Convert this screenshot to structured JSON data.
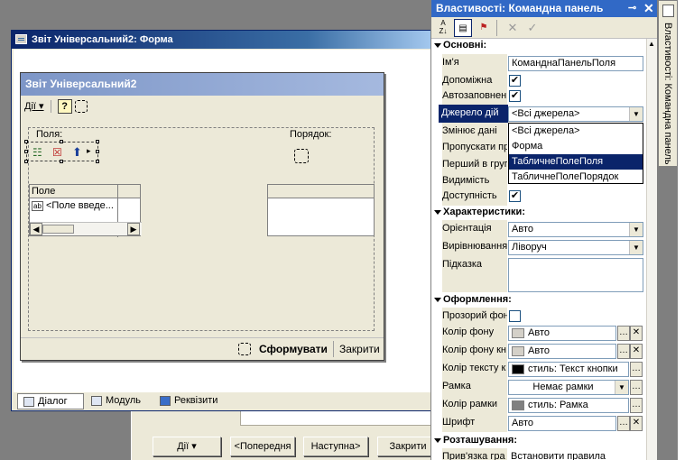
{
  "form_window": {
    "title": "Звіт Універсальний2: Форма",
    "tabs": [
      {
        "label": "Діалог",
        "icon": "dialog-icon"
      },
      {
        "label": "Модуль",
        "icon": "module-icon"
      },
      {
        "label": "Реквізити",
        "icon": "attributes-icon"
      }
    ]
  },
  "inner_form": {
    "title": "Звіт  Універсальний2",
    "menu_label": "Дії",
    "fields_label": "Поля:",
    "order_label": "Порядок:",
    "fields_table": {
      "header": "Поле",
      "row": "<Поле введе..."
    },
    "generate_button": "Сформувати",
    "close_button": "Закрити"
  },
  "background_dialog": {
    "buttons": [
      "Дії",
      "<Попередня",
      "Наступна>",
      "Закрити"
    ]
  },
  "properties": {
    "title": "Властивості: Командна панель",
    "pin_icon": "pin-icon",
    "close_icon": "close-icon",
    "sections": {
      "main": "Основні:",
      "characteristics": "Характеристики:",
      "appearance": "Оформлення:",
      "placement": "Розташування:"
    },
    "rows": {
      "name": {
        "label": "Ім'я",
        "value": "КоманднаПанельПоля"
      },
      "auxiliary": {
        "label": "Допоміжна",
        "checked": true
      },
      "autofill": {
        "label": "Автозаповнен",
        "checked": true
      },
      "action_source": {
        "label": "Джерело дій",
        "value": "<Всі джерела>"
      },
      "changes_data": {
        "label": "Змінює дані"
      },
      "skip": {
        "label": "Пропускати пр"
      },
      "first_group": {
        "label": "Перший в груп"
      },
      "visibility": {
        "label": "Видимість"
      },
      "availability": {
        "label": "Доступність",
        "checked": true
      },
      "orientation": {
        "label": "Орієнтація",
        "value": "Авто"
      },
      "alignment": {
        "label": "Вирівнювання",
        "value": "Ліворуч"
      },
      "hint": {
        "label": "Підказка",
        "value": ""
      },
      "transparent_bg": {
        "label": "Прозорий фон",
        "checked": false
      },
      "bg_color": {
        "label": "Колір фону",
        "value": "Авто"
      },
      "button_bg_color": {
        "label": "Колір фону кн",
        "value": "Авто"
      },
      "text_color": {
        "label": "Колір тексту к",
        "value": "стиль: Текст кнопки"
      },
      "frame": {
        "label": "Рамка",
        "value": "Немає рамки"
      },
      "frame_color": {
        "label": "Колір рамки",
        "value": "стиль: Рамка"
      },
      "font": {
        "label": "Шрифт",
        "value": "Авто"
      },
      "binding": {
        "label": "Прив'язка гра",
        "value": "Встановити правила"
      }
    },
    "dropdown_options": [
      "<Всі джерела>",
      "Форма",
      "ТабличнеПолеПоля",
      "ТабличнеПолеПорядок"
    ],
    "dropdown_selected": "ТабличнеПолеПоля",
    "side_tab_label": "Властивості: Командна панель",
    "colors": {
      "title_bar": "#3169c6",
      "selection": "#0a246a",
      "text_color_swatch": "#000000",
      "frame_color_swatch": "#808080",
      "bg_swatch": "#d4d0c8"
    }
  }
}
